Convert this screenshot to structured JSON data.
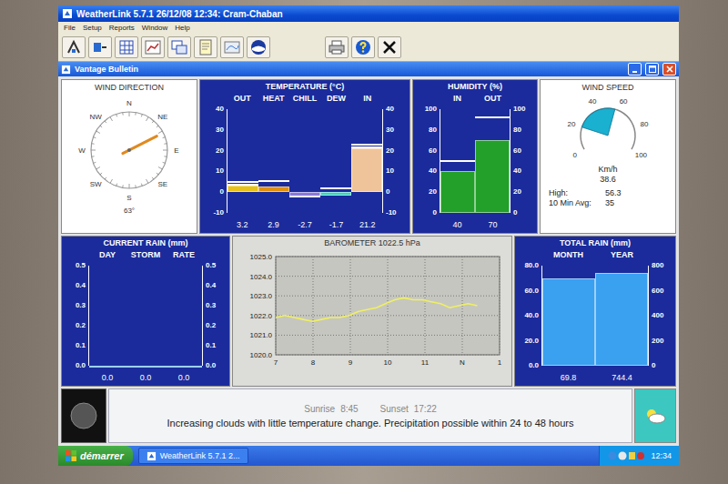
{
  "window": {
    "title": "WeatherLink 5.7.1 26/12/08 12:34: Cram-Chaban"
  },
  "menu": [
    "File",
    "Setup",
    "Reports",
    "Window",
    "Help"
  ],
  "document": {
    "title": "Vantage Bulletin"
  },
  "wind_direction": {
    "title": "WIND DIRECTION",
    "compass": [
      "N",
      "NE",
      "E",
      "SE",
      "S",
      "SW",
      "W",
      "NW"
    ],
    "bearing": 63,
    "reading": "63°"
  },
  "temperature": {
    "title": "TEMPERATURE (°C)",
    "ticks": [
      "40",
      "30",
      "20",
      "10",
      "0",
      "-10"
    ],
    "bars": [
      {
        "label": "OUT",
        "reading": "3.2",
        "value": 3.2,
        "marks": [
          5.0,
          3.5
        ],
        "color": "#e8c21c"
      },
      {
        "label": "HEAT",
        "reading": "2.9",
        "value": 2.9,
        "marks": [
          5.5
        ],
        "color": "#e0900e"
      },
      {
        "label": "CHILL",
        "reading": "-2.7",
        "value": -2.7,
        "marks": [
          -2.0
        ],
        "color": "#8a7ad8"
      },
      {
        "label": "DEW",
        "reading": "-1.7",
        "value": -1.7,
        "marks": [
          2.0
        ],
        "color": "#3cd2c0"
      },
      {
        "label": "IN",
        "reading": "21.2",
        "value": 21.2,
        "marks": [
          23.0,
          21.5
        ],
        "color": "#f0c49a"
      }
    ]
  },
  "humidity": {
    "title": "HUMIDITY (%)",
    "ticks": [
      "100",
      "80",
      "60",
      "40",
      "20",
      "0"
    ],
    "bars": [
      {
        "label": "IN",
        "reading": "40",
        "value": 40,
        "marks": [
          50
        ],
        "color": "#22a02a"
      },
      {
        "label": "OUT",
        "reading": "70",
        "value": 70,
        "marks": [
          92
        ],
        "color": "#22a02a"
      }
    ]
  },
  "wind_speed": {
    "title": "WIND SPEED",
    "ticks": [
      "0",
      "20",
      "40",
      "60",
      "80",
      "100"
    ],
    "range_low": 20,
    "range_high": 56.3,
    "unit": "Km/h",
    "reading": "38.6",
    "stats": [
      {
        "label": "High:",
        "value": "56.3"
      },
      {
        "label": "10 Min Avg:",
        "value": "35"
      }
    ]
  },
  "current_rain": {
    "title": "CURRENT RAIN (mm)",
    "ticks": [
      "0.5",
      "0.4",
      "0.3",
      "0.2",
      "0.1",
      "0.0"
    ],
    "bars": [
      {
        "label": "DAY",
        "reading": "0.0",
        "value": 0,
        "marks": [],
        "color": "#3aa0f0"
      },
      {
        "label": "STORM",
        "reading": "0.0",
        "value": 0,
        "marks": [],
        "color": "#3aa0f0"
      },
      {
        "label": "RATE",
        "reading": "0.0",
        "value": 0,
        "marks": [],
        "color": "#3aa0f0"
      }
    ]
  },
  "barometer": {
    "title": "BAROMETER 1022.5 hPa",
    "y_ticks": [
      "1025.0",
      "1024.0",
      "1023.0",
      "1022.0",
      "1021.0",
      "1020.0"
    ],
    "x_ticks": [
      "7",
      "8",
      "9",
      "10",
      "11",
      "N",
      "1"
    ],
    "span": 0.9,
    "values": [
      1021.9,
      1022.0,
      1021.9,
      1021.8,
      1021.7,
      1021.8,
      1021.9,
      1021.9,
      1022.0,
      1022.2,
      1022.3,
      1022.4,
      1022.6,
      1022.8,
      1022.9,
      1022.8,
      1022.8,
      1022.7,
      1022.6,
      1022.4,
      1022.5,
      1022.6,
      1022.5
    ]
  },
  "total_rain": {
    "title": "TOTAL RAIN (mm)",
    "ticks": [
      "80.0",
      "60.0",
      "40.0",
      "20.0",
      "0.0"
    ],
    "ticks_right": [
      "800",
      "600",
      "400",
      "200",
      "0"
    ],
    "bars": [
      {
        "label": "MONTH",
        "reading": "69.8",
        "value": 69.8,
        "axis": "left",
        "marks": [],
        "color": "#3aa0f0"
      },
      {
        "label": "YEAR",
        "reading": "744.4",
        "value": 744.4,
        "axis": "right",
        "marks": [],
        "color": "#3aa0f0"
      }
    ]
  },
  "sun": [
    {
      "label": "Sunrise",
      "time": "8:45"
    },
    {
      "label": "Sunset",
      "time": "17:22"
    }
  ],
  "forecast": "Increasing clouds with little temperature change.  Precipitation possible within 24 to 48 hours",
  "taskbar": {
    "start": "démarrer",
    "tasks": [
      {
        "label": "WeatherLink 5.7.1  2...",
        "selected": false
      }
    ],
    "clock": "12:34"
  }
}
